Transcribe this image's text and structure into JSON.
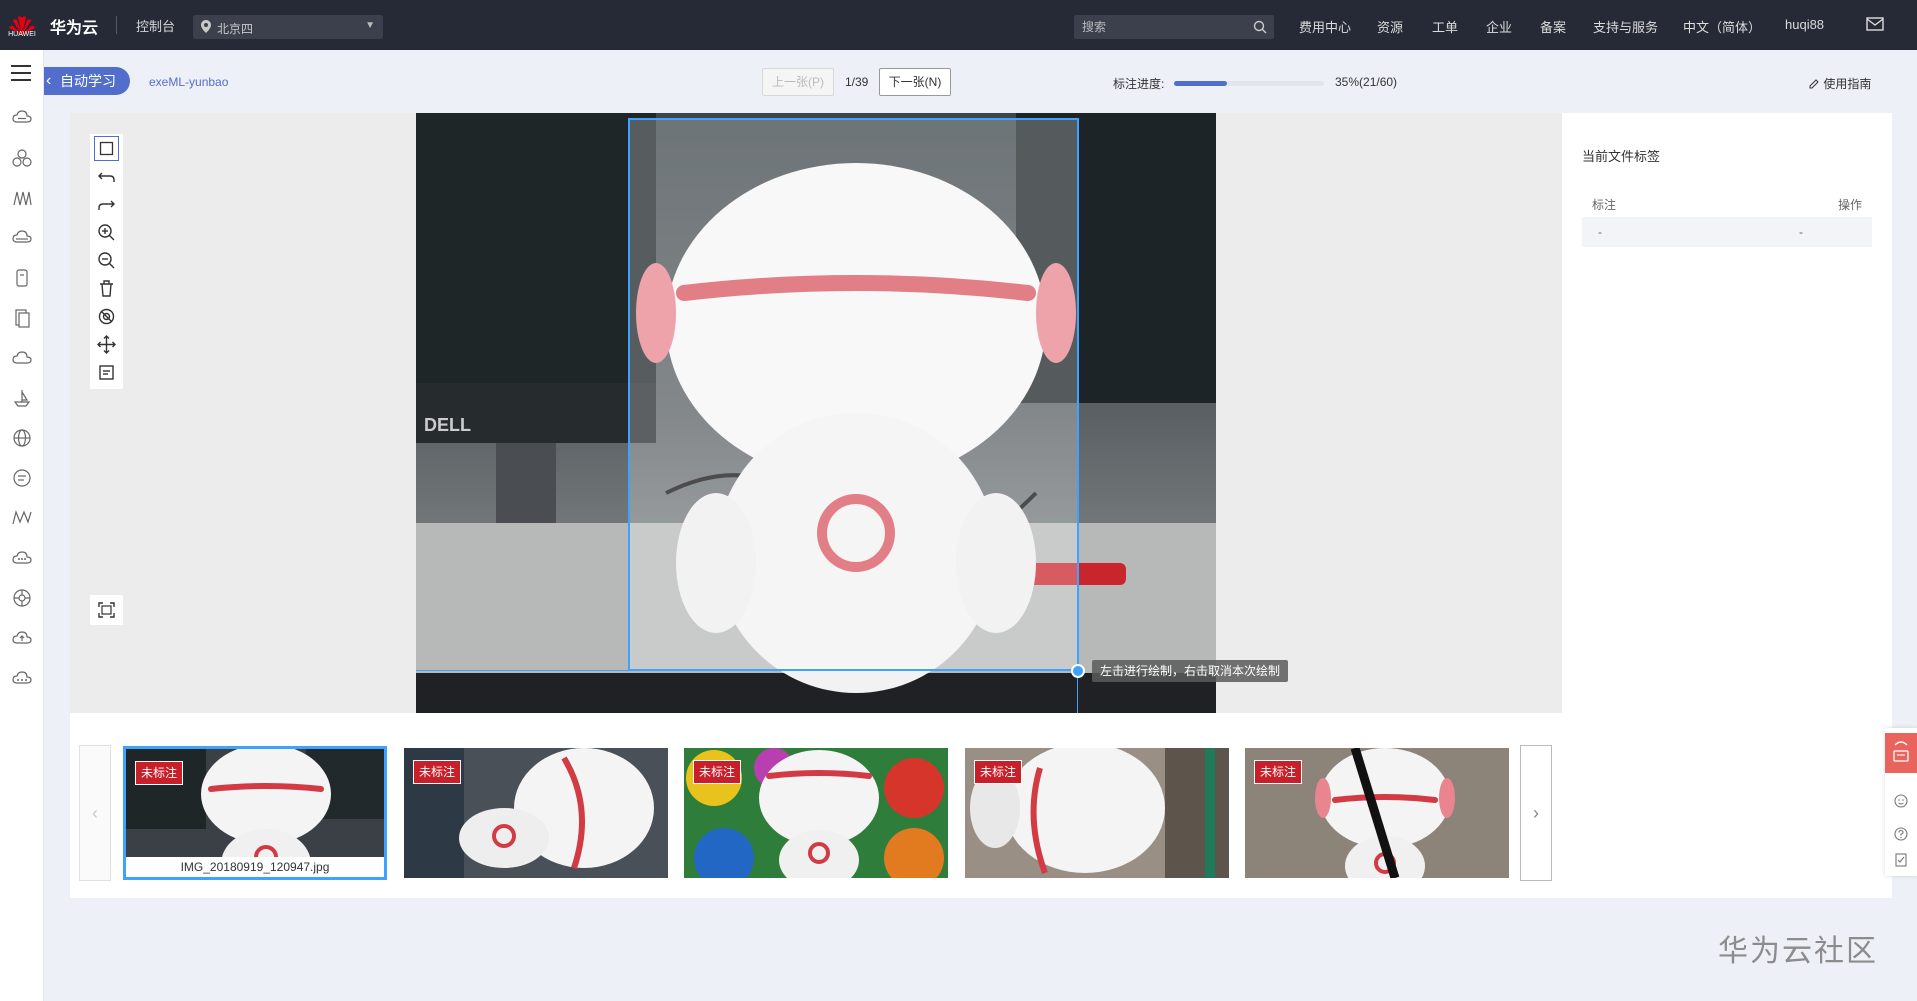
{
  "topbar": {
    "logo_text": "HUAWEI",
    "brand": "华为云",
    "console": "控制台",
    "region": "北京四",
    "search_placeholder": "搜索",
    "nav": [
      "费用中心",
      "资源",
      "工单",
      "企业",
      "备案",
      "支持与服务",
      "中文（简体）",
      "huqi88"
    ]
  },
  "sidebar": {
    "icons": [
      "cloud-icon",
      "cluster-icon",
      "model-icon",
      "database-icon",
      "storage-icon",
      "document-icon",
      "cloud-icon",
      "ship-icon",
      "globe-icon",
      "chat-icon",
      "modelarts-icon",
      "cloud-service-icon",
      "network-icon",
      "cloud-upload-icon",
      "cloud-more-icon"
    ]
  },
  "header": {
    "back_label": "自动学习",
    "project_name": "exeML-yunbao",
    "prev_label": "上一张(P)",
    "page_indicator": "1/39",
    "next_label": "下一张(N)",
    "progress_label": "标注进度:",
    "progress_value": 0.35,
    "progress_text": "35%(21/60)",
    "guide_label": "使用指南"
  },
  "toolbar": {
    "tools": [
      "rectangle-icon",
      "undo-icon",
      "redo-icon",
      "zoom-in-icon",
      "zoom-out-icon",
      "delete-icon",
      "hide-icon",
      "move-icon",
      "fit-label-icon"
    ],
    "fit_icon": "fullscreen-icon"
  },
  "canvas": {
    "tooltip": "左击进行绘制，右击取消本次绘制",
    "monitor_brand": "DELL"
  },
  "right_panel": {
    "title": "当前文件标签",
    "col_label": "标注",
    "col_action": "操作",
    "row_label": "-",
    "row_action": "-"
  },
  "filmstrip": {
    "items": [
      {
        "tag": "未标注",
        "filename": "IMG_20180919_120947.jpg",
        "selected": true
      },
      {
        "tag": "未标注"
      },
      {
        "tag": "未标注"
      },
      {
        "tag": "未标注"
      },
      {
        "tag": "未标注"
      }
    ]
  },
  "watermark": "华为云社区",
  "colors": {
    "accent": "#526ecc",
    "bbox": "#3ea2ff",
    "tag_red": "#c7202a",
    "topbar": "#262a36"
  }
}
